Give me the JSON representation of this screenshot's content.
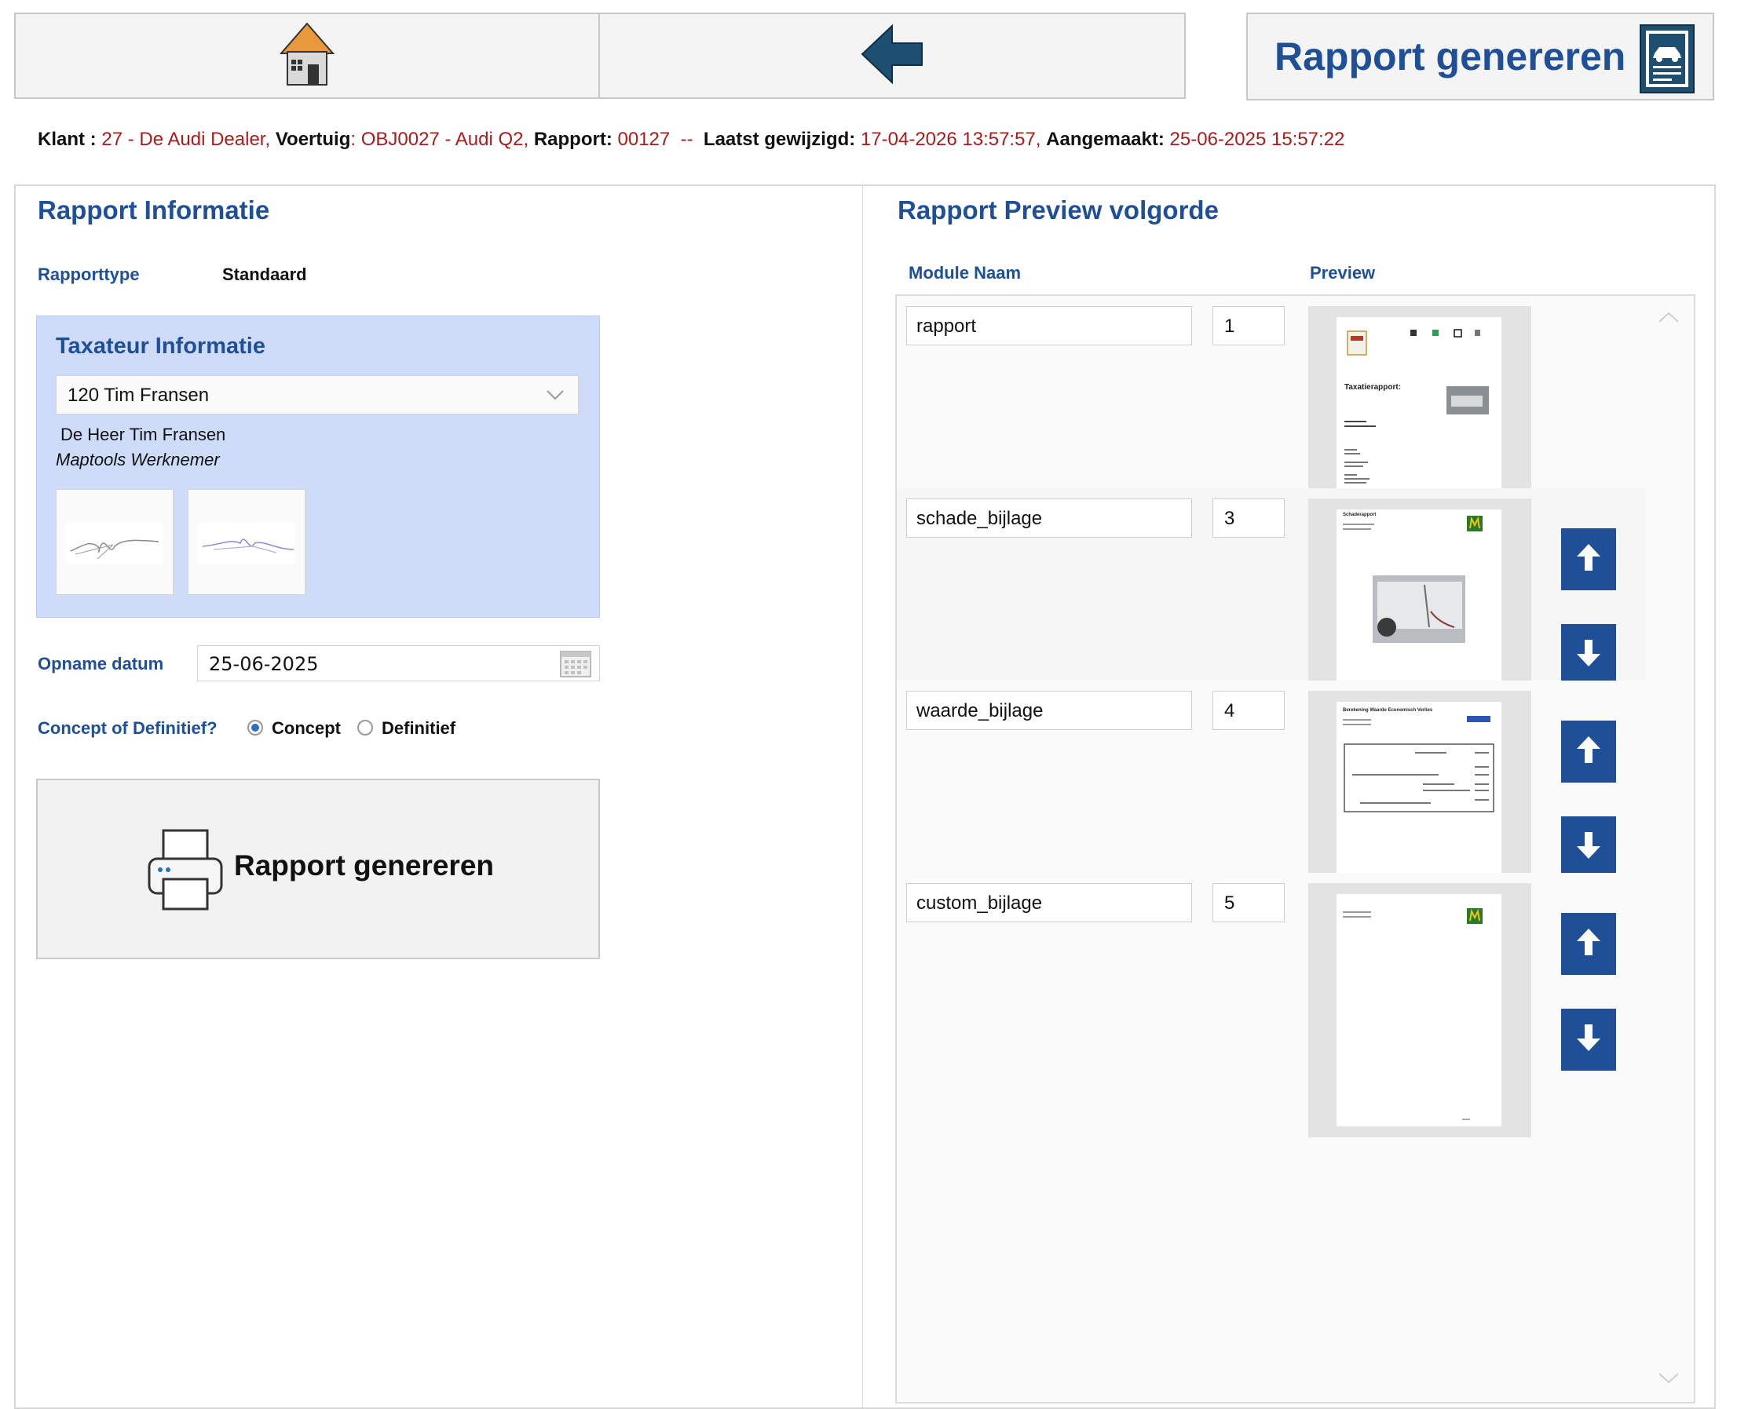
{
  "toolbar": {
    "home_icon": "home-icon",
    "back_icon": "back-arrow-icon",
    "generate_label": "Rapport genereren",
    "generate_icon": "report-car-icon"
  },
  "info": {
    "klant_label": "Klant :",
    "klant_value": "27 - De Audi Dealer,",
    "voertuig_label": "Voertuig",
    "voertuig_value": ": OBJ0027 - Audi Q2,",
    "rapport_label": "Rapport:",
    "rapport_value": "00127  --",
    "gewijzigd_label": "Laatst gewijzigd:",
    "gewijzigd_value": "17-04-2026 13:57:57,",
    "aangemaakt_label": "Aangemaakt:",
    "aangemaakt_value": "25-06-2025 15:57:22"
  },
  "left": {
    "title": "Rapport Informatie",
    "rapporttype_label": "Rapporttype",
    "rapporttype_value": "Standaard",
    "taxateur": {
      "title": "Taxateur Informatie",
      "selected": "120 Tim Fransen",
      "name": "De Heer Tim Fransen",
      "role": "Maptools Werknemer"
    },
    "opname_label": "Opname datum",
    "opname_value": "25-06-2025",
    "concept_question": "Concept of Definitief?",
    "concept_option": "Concept",
    "definitief_option": "Definitief",
    "concept_selected": true,
    "generate_label": "Rapport genereren"
  },
  "right": {
    "title": "Rapport Preview volgorde",
    "col_module": "Module Naam",
    "col_preview": "Preview",
    "modules": [
      {
        "name": "rapport",
        "order": "1"
      },
      {
        "name": "schade_bijlage",
        "order": "3"
      },
      {
        "name": "waarde_bijlage",
        "order": "4"
      },
      {
        "name": "custom_bijlage",
        "order": "5"
      }
    ],
    "preview_text": {
      "taxatierapport": "Taxatierapport:",
      "schaderapport": "Schaderapport",
      "berekening": "Berekening Waarde Economisch Verlies"
    }
  },
  "colors": {
    "accent": "#1f4f96",
    "value_red": "#a51d1d",
    "taxateur_bg": "#cfdcf9",
    "home_roof": "#e7993c"
  }
}
